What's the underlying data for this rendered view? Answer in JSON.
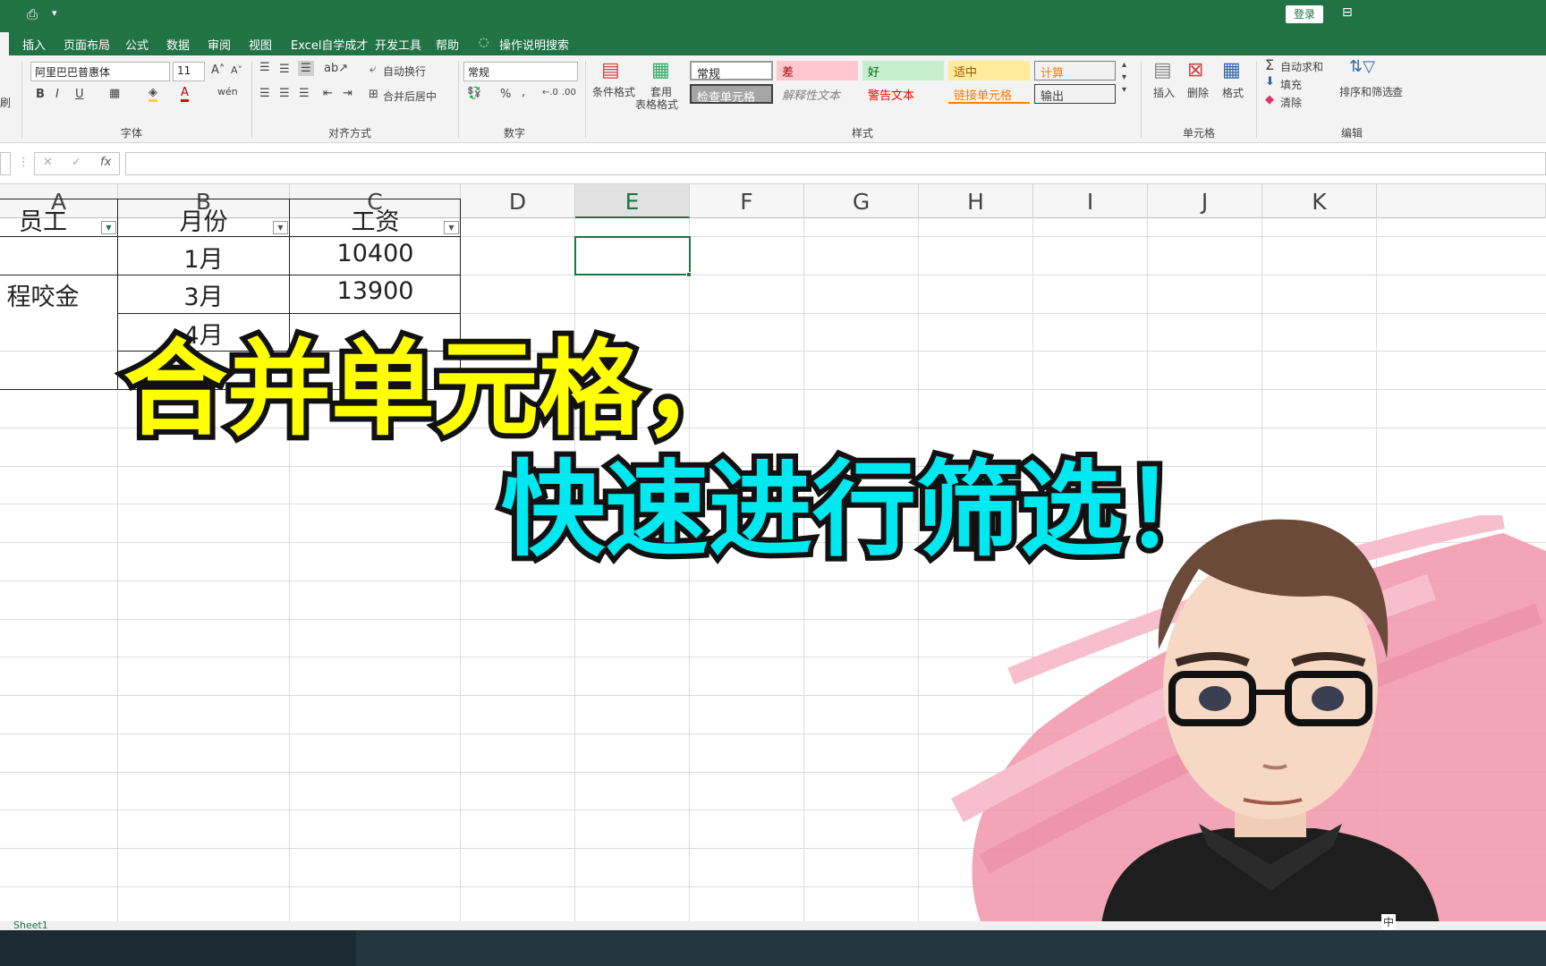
{
  "titlebar": {
    "quick_access_more": "▾",
    "login_label": "登录"
  },
  "menu": {
    "tabs": [
      "插入",
      "页面布局",
      "公式",
      "数据",
      "审阅",
      "视图",
      "Excel自学成才",
      "开发工具",
      "帮助"
    ],
    "tell_me": "操作说明搜索"
  },
  "ribbon": {
    "font_name": "阿里巴巴普惠体",
    "font_size": "11",
    "font_group": "字体",
    "wrap_text": "自动换行",
    "merge_center": "合并后居中",
    "align_group": "对齐方式",
    "number_format": "常规",
    "number_group": "数字",
    "cond_format": "条件格式",
    "table_format_1": "套用",
    "table_format_2": "表格格式",
    "styles": {
      "normal": "常规",
      "bad": "差",
      "good": "好",
      "neutral": "适中",
      "calc": "计算",
      "check": "检查单元格",
      "explain": "解释性文本",
      "warning": "警告文本",
      "linked": "链接单元格",
      "output": "输出"
    },
    "styles_group": "样式",
    "insert": "插入",
    "delete": "删除",
    "format": "格式",
    "cells_group": "单元格",
    "autosum": "自动求和",
    "fill": "填充",
    "clear": "清除",
    "sort_filter": "排序和筛选",
    "find": "查",
    "edit_group": "编辑",
    "left_edge": "刷"
  },
  "formula_bar": {
    "cancel": "✕",
    "enter": "✓",
    "fx": "fx",
    "value": ""
  },
  "columns": [
    "A",
    "B",
    "C",
    "D",
    "E",
    "F",
    "G",
    "H",
    "I",
    "J",
    "K"
  ],
  "table": {
    "headers": [
      "员工",
      "月份",
      "工资"
    ],
    "merged_employee": "程咬金",
    "rows": [
      {
        "month": "1月",
        "salary": "10400"
      },
      {
        "month": "3月",
        "salary": "13900"
      },
      {
        "month": "4月",
        "salary": ""
      }
    ]
  },
  "overlay": {
    "line1": "合并单元格，",
    "line2": "快速进行筛选！"
  },
  "sheet_tab": "Sheet1",
  "status": {
    "ime": "中"
  },
  "colors": {
    "excel_green": "#217346",
    "overlay_yellow": "#ffff00",
    "overlay_cyan": "#00e8f0",
    "selection": "#217346"
  }
}
